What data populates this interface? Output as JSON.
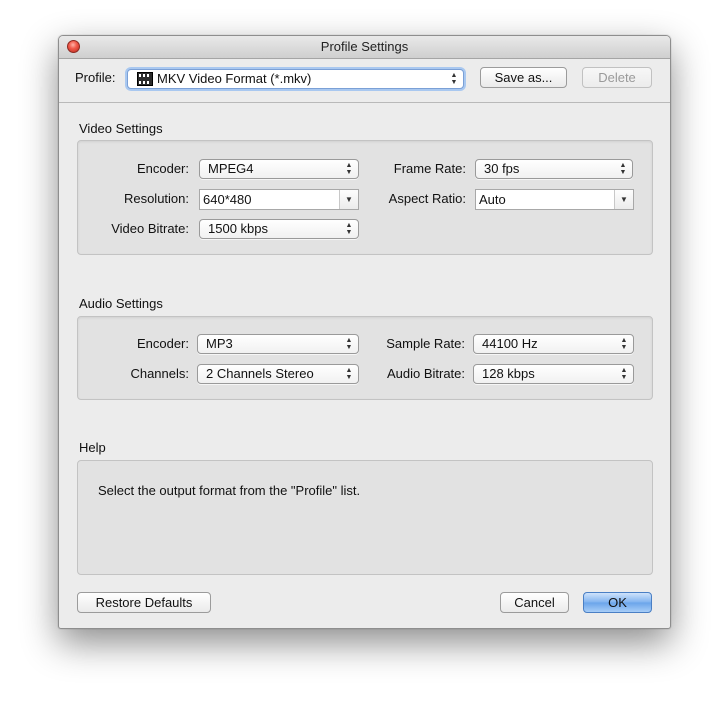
{
  "window": {
    "title": "Profile Settings"
  },
  "profile": {
    "label": "Profile:",
    "selected": "MKV Video Format (*.mkv)",
    "icon": "mkv-format-icon",
    "save_as": "Save as...",
    "delete": "Delete"
  },
  "video": {
    "title": "Video Settings",
    "encoder_label": "Encoder:",
    "encoder_value": "MPEG4",
    "frame_rate_label": "Frame Rate:",
    "frame_rate_value": "30 fps",
    "resolution_label": "Resolution:",
    "resolution_value": "640*480",
    "aspect_ratio_label": "Aspect Ratio:",
    "aspect_ratio_value": "Auto",
    "bitrate_label": "Video Bitrate:",
    "bitrate_value": "1500 kbps"
  },
  "audio": {
    "title": "Audio Settings",
    "encoder_label": "Encoder:",
    "encoder_value": "MP3",
    "sample_rate_label": "Sample Rate:",
    "sample_rate_value": "44100 Hz",
    "channels_label": "Channels:",
    "channels_value": "2 Channels Stereo",
    "bitrate_label": "Audio Bitrate:",
    "bitrate_value": "128 kbps"
  },
  "help": {
    "title": "Help",
    "text": "Select the output format from the \"Profile\" list."
  },
  "buttons": {
    "restore": "Restore Defaults",
    "cancel": "Cancel",
    "ok": "OK"
  },
  "colors": {
    "default_button": "#6aa4ea",
    "close_button": "#f05a4b"
  }
}
